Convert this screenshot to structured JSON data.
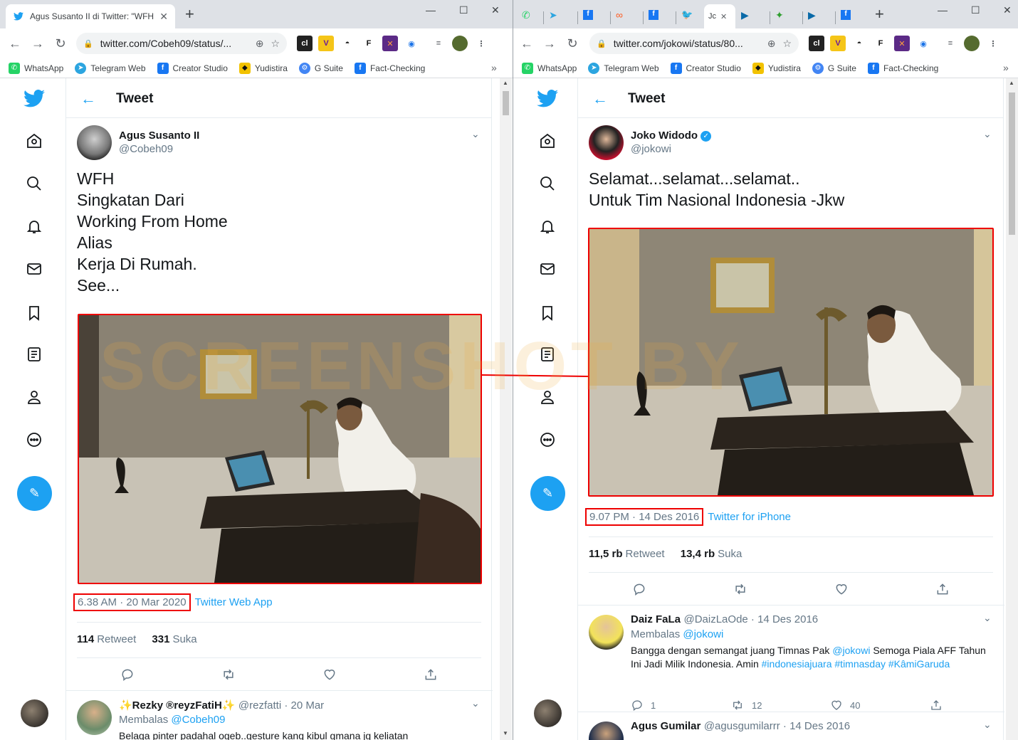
{
  "left": {
    "tab_title": "Agus Susanto II di Twitter: \"WFH",
    "url": "twitter.com/Cobeh09/status/...",
    "bookmarks": [
      {
        "label": "WhatsApp",
        "icon": "whatsapp-icon",
        "color": "#25d366"
      },
      {
        "label": "Telegram Web",
        "icon": "telegram-icon",
        "color": "#2ca5e0"
      },
      {
        "label": "Creator Studio",
        "icon": "facebook-icon",
        "color": "#1877f2"
      },
      {
        "label": "Yudistira",
        "icon": "batman-icon",
        "color": "#f2c200"
      },
      {
        "label": "G Suite",
        "icon": "gsuite-icon",
        "color": "#4285f4"
      },
      {
        "label": "Fact-Checking",
        "icon": "facebook-icon",
        "color": "#1877f2"
      }
    ],
    "header_title": "Tweet",
    "author_name": "Agus Susanto II",
    "author_handle": "@Cobeh09",
    "text": "WFH\nSingkatan Dari\nWorking From Home\nAlias\nKerja Di Rumah.\nSee...",
    "timestamp": "6.38 AM · 20 Mar 2020",
    "source": "Twitter Web App",
    "retweets_count": "114",
    "retweets_label": "Retweet",
    "likes_count": "331",
    "likes_label": "Suka",
    "reply": {
      "name": "✨Rezky ®reyzFatiH✨",
      "meta": "@rezfatti · 20 Mar",
      "to_prefix": "Membalas",
      "to_handle": "@Cobeh09",
      "text": "Belaga pinter padahal ogeb..gesture kang kibul gmana jg keliatan"
    }
  },
  "right": {
    "tab_active_title": "Jc",
    "url": "twitter.com/jokowi/status/80...",
    "header_title": "Tweet",
    "author_name": "Joko Widodo",
    "author_handle": "@jokowi",
    "text": "Selamat...selamat...selamat..\nUntuk Tim Nasional Indonesia -Jkw",
    "timestamp": "9.07 PM · 14 Des 2016",
    "source": "Twitter for iPhone",
    "retweets_count": "11,5 rb",
    "retweets_label": "Retweet",
    "likes_count": "13,4 rb",
    "likes_label": "Suka",
    "reply1": {
      "name": "Daiz FaLa",
      "meta": "@DaizLaOde · 14 Des 2016",
      "to_prefix": "Membalas",
      "to_handle": "@jokowi",
      "text_parts": [
        "Bangga dengan semangat juang Timnas Pak ",
        "@jokowi",
        " Semoga Piala AFF Tahun Ini Jadi Milik Indonesia. Amin ",
        "#indonesiajuara",
        " ",
        "#timnasday",
        " ",
        "#KâmiGaruda"
      ],
      "reply_count": "1",
      "retweet_count": "12",
      "like_count": "40"
    },
    "reply2": {
      "name": "Agus Gumilar",
      "meta": "@agusgumilarrr · 14 Des 2016"
    }
  },
  "watermark": "SCREENSHOT BY",
  "colors": {
    "twitter_blue": "#1da1f2",
    "highlight_red": "#e00000",
    "muted": "#657786"
  }
}
